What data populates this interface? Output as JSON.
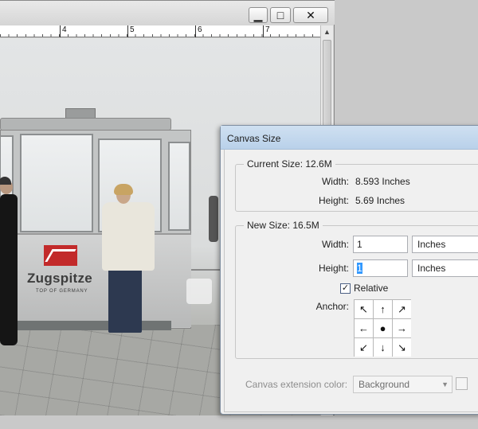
{
  "document": {
    "controls": {
      "minimize": "▁",
      "maximize": "□",
      "close": "✕"
    },
    "ruler_labels": [
      "4",
      "5",
      "6",
      "7"
    ],
    "photo_sign": {
      "brand": "Zugspitze",
      "tagline": "TOP OF GERMANY"
    }
  },
  "dialog": {
    "title": "Canvas Size",
    "current_size": {
      "legend": "Current Size: 12.6M",
      "width_label": "Width:",
      "width_value": "8.593 Inches",
      "height_label": "Height:",
      "height_value": "5.69 Inches"
    },
    "new_size": {
      "legend": "New Size: 16.5M",
      "width_label": "Width:",
      "width_value": "1",
      "width_unit": "Inches",
      "height_label": "Height:",
      "height_value": "1",
      "height_unit": "Inches",
      "relative_label": "Relative",
      "relative_checked": true,
      "anchor_label": "Anchor:",
      "anchor_cells": [
        "↖",
        "↑",
        "↗",
        "←",
        "●",
        "→",
        "↙",
        "↓",
        "↘"
      ]
    },
    "extension": {
      "label": "Canvas extension color:",
      "value": "Background",
      "caret": "▼"
    }
  }
}
